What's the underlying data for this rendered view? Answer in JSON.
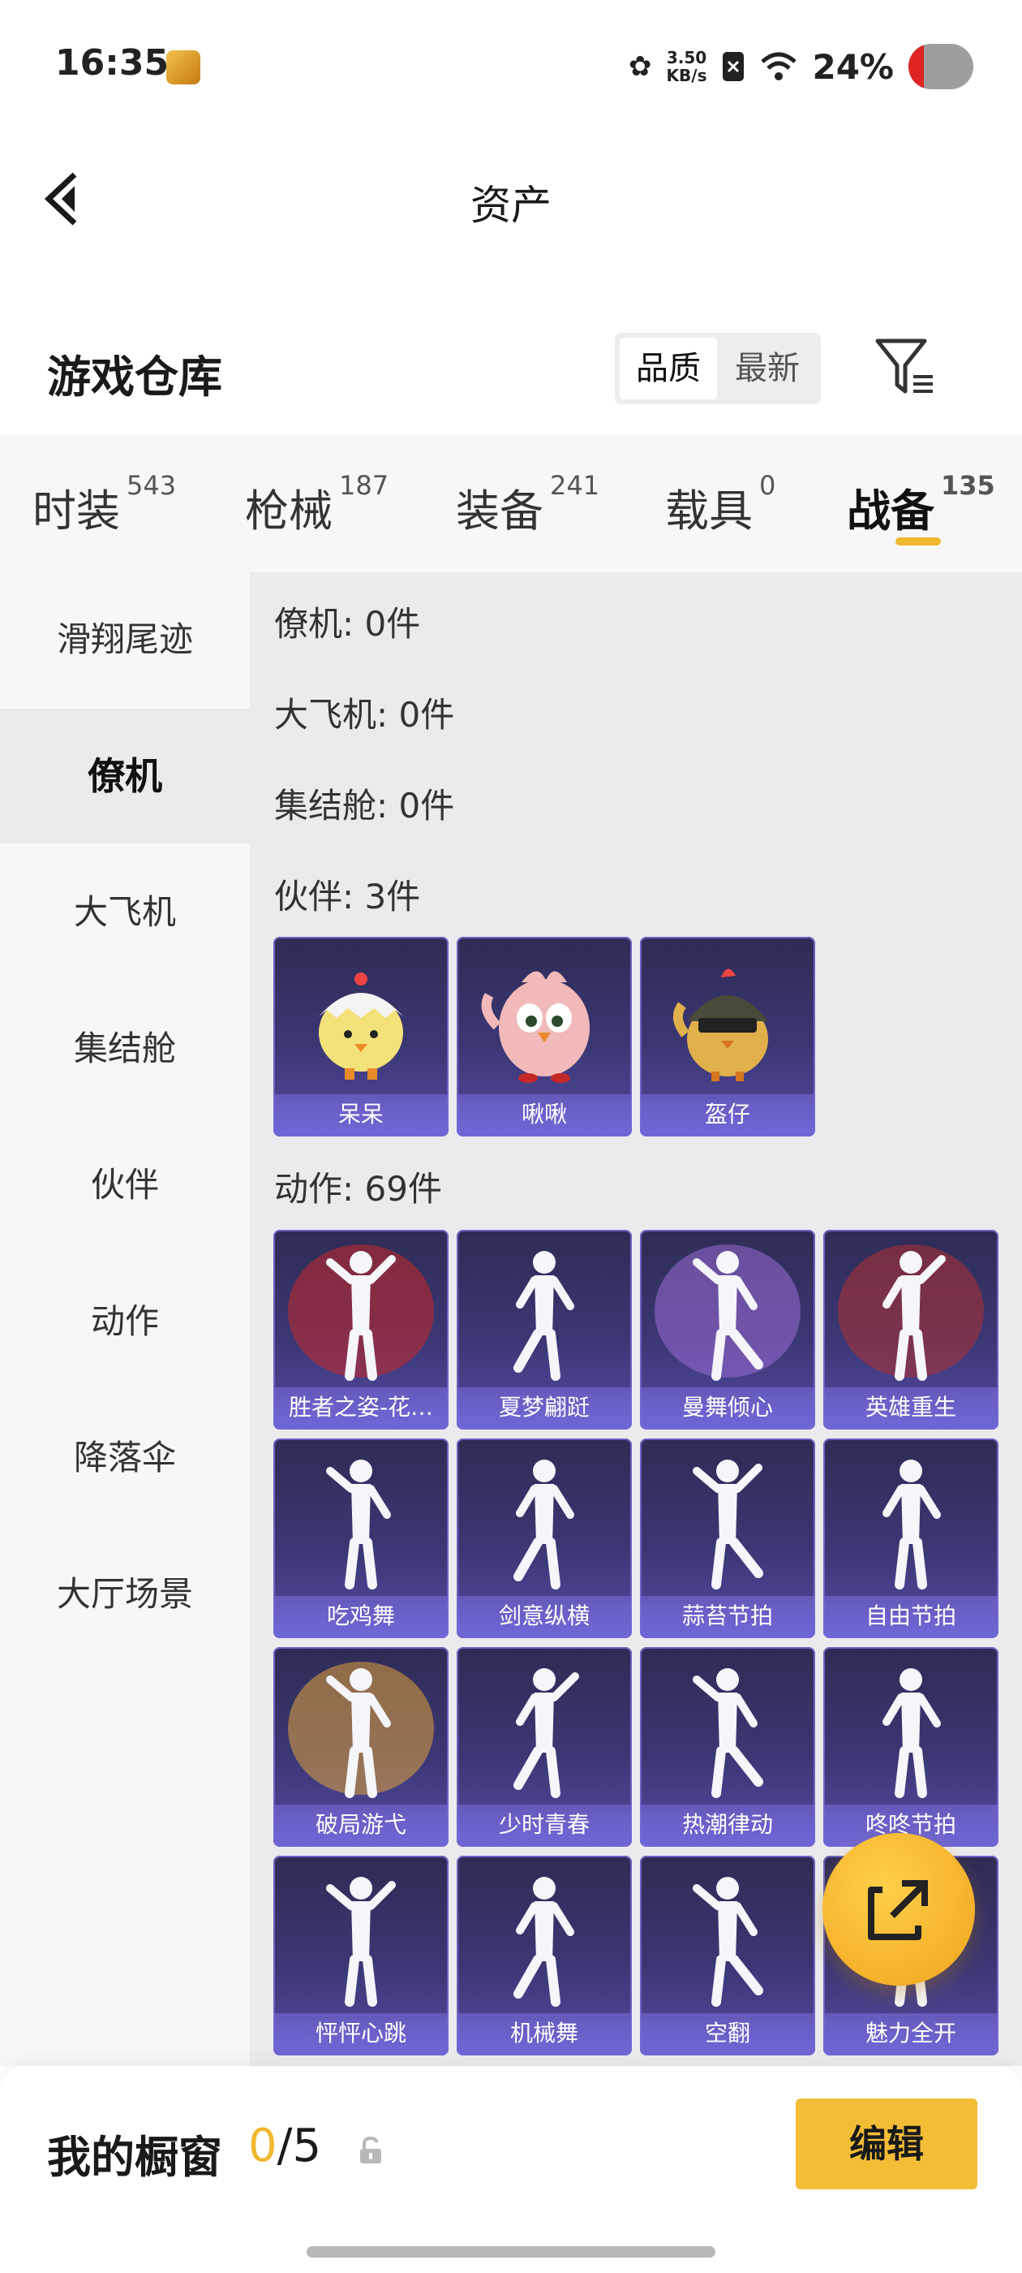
{
  "status_bar": {
    "time": "16:35",
    "net_speed_value": "3.50",
    "net_speed_unit": "KB/s",
    "battery": "24%",
    "icons": [
      "app-icon",
      "flower-icon",
      "sim-off-icon",
      "wifi-icon",
      "battery-icon"
    ]
  },
  "nav": {
    "title": "资产"
  },
  "warehouse": {
    "title": "游戏仓库",
    "sort_options": [
      "品质",
      "最新"
    ],
    "sort_selected": "品质"
  },
  "tabs": [
    {
      "label": "时装",
      "count": "543"
    },
    {
      "label": "枪械",
      "count": "187"
    },
    {
      "label": "装备",
      "count": "241"
    },
    {
      "label": "载具",
      "count": "0"
    },
    {
      "label": "战备",
      "count": "135"
    }
  ],
  "active_tab": "战备",
  "sidebar": {
    "items": [
      "滑翔尾迹",
      "僚机",
      "大飞机",
      "集结舱",
      "伙伴",
      "动作",
      "降落伞",
      "大厅场景"
    ],
    "active": "僚机"
  },
  "content": {
    "sections": [
      {
        "label": "僚机: 0件"
      },
      {
        "label": "大飞机: 0件"
      },
      {
        "label": "集结舱: 0件"
      },
      {
        "label": "伙伴: 3件",
        "items": [
          "呆呆",
          "啾啾",
          "盔仔"
        ]
      },
      {
        "label": "动作: 69件",
        "items": [
          "胜者之姿-花…",
          "夏梦翩跹",
          "曼舞倾心",
          "英雄重生",
          "吃鸡舞",
          "剑意纵横",
          "蒜苔节拍",
          "自由节拍",
          "破局游弋",
          "少时青春",
          "热潮律动",
          "咚咚节拍",
          "怦怦心跳",
          "机械舞",
          "空翻",
          "魅力全开"
        ]
      }
    ]
  },
  "bottom_bar": {
    "title": "我的橱窗",
    "count_current": "0",
    "count_total": "/5",
    "edit_label": "编辑"
  },
  "colors": {
    "accent": "#f1b72f",
    "card_bg": "#3b3774",
    "card_label_bg": "#6f67d6",
    "panel_bg": "#ebebee"
  }
}
